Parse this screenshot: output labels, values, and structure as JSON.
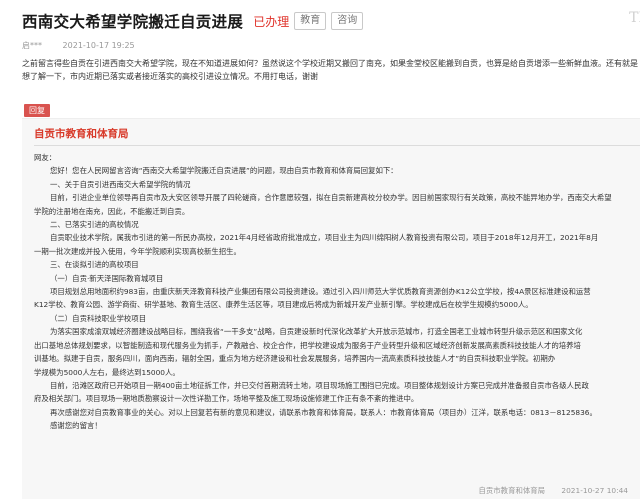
{
  "header": {
    "title": "西南交大希望学院搬迁自贡进展",
    "status": "已办理",
    "tags": [
      "教育",
      "咨询"
    ],
    "watermark": "TI"
  },
  "meta": {
    "author": "启***",
    "datetime": "2021-10-17 19:25"
  },
  "question": {
    "lines": [
      "之前留言得些自贡在引进西南交大希望学院，现在不知道进展如何？虽然说这个学校近期又搬回了南充，如果金堂校区能搬到自贡，也算是给自贡增添一些新鲜血液。还有就是",
      "想了解一下，市内近期已落实或者接近落实的高校引进设立情况。不用打电话，谢谢"
    ]
  },
  "reply": {
    "tag": "回复",
    "department": "自贡市教育和体育局",
    "paragraphs": [
      "网友：",
      "您好！您在人民网留言咨询“西南交大希望学院搬迁自贡进展”的问题，现由自贡市教育和体育局回复如下：",
      "一、关于自贡引进西南交大希望学院的情况",
      "目前，引进企业单位领导再自贡市及大安区领导开展了四轮磋商，合作意愿较强，拟在自贡新建高校分校办学。因目前国家现行有关政策，高校不能异地办学，西南交大希望",
      "学院的注册地在南充，因此，不能搬迁到自贡。",
      "二、已落实引进的高校情况",
      "自贡职业技术学院，属我市引进的第一所民办高校，2021年4月经省政府批准成立，项目业主为四川绵阳树人教育投资有限公司，项目于2018年12月开工，2021年8月",
      "一期一批次建成并投入使用，今年学院顺利实现高校新生招生。",
      "三、在谈拟引进的高校项目",
      "（一）自贡·新天泽国际教育城项目",
      "项目规划总用地面积约983亩，由重庆新天泽教育科技产业集团有限公司投资建设。通过引入四川师范大学优质教育资源创办K12公立学校，按4A景区标准建设和运营",
      "K12学校、教育公园、游学商街、研学基地、教育生活区、康养生活区等，项目建成后将成为新城开发产业新引擎。学校建成后在校学生规模约5000人。",
      "（二）自贡科技职业学校项目",
      "为落实国家成渝双城经济圈建设战略目标，围绕我省“一干多支”战略，自贡建设新时代深化改革扩大开放示范城市，打造全国老工业城市转型升级示范区和国家文化",
      "出口基地总体规划要求，以智能制造和现代服务业为抓手，产教融合、校企合作，把学校建设成为服务于产业转型升级和区域经济创新发展高素质科技技能人才的培养培",
      "训基地。拟建于自贡，服务四川，面向西南，辐射全国，重点为地方经济建设和社会发展服务，培养国内一流高素质科技技能人才”的自贡科技职业学院。初期办",
      "学规模为5000人左右，最终达到15000人。",
      "目前，沿滩区政府已开始项目一期400亩土地征拆工作，并已交付首期流转土地，项目现场施工围挡已完成。项目整体规划设计方案已完成并准备报自贡市各级人民政",
      "府及相关部门。项目现场一期地质勘察设计一次性详勘工作，场地平整及施工现场设施修建工作正有条不紊的推进中。",
      "再次感谢您对自贡教育事业的关心。对以上回复若有新的意见和建议，请联系市教育和体育局，联系人：市教育体育局（项目办）江洋，联系电话：0813－8125836。",
      "感谢您的留言！"
    ],
    "footer_author": "自贡市教育和体育局",
    "footer_datetime": "2021-10-27 10:44"
  },
  "colors": {
    "accent": "#d83a2a",
    "status": "#e0332b",
    "reply_tag_bg": "#d9534f",
    "panel_bg": "#f7f7f7"
  }
}
